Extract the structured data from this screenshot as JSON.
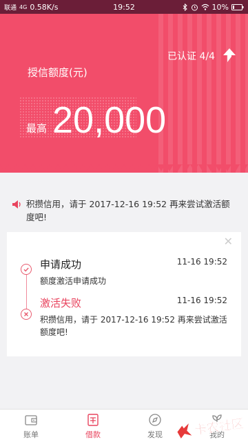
{
  "status_bar": {
    "carrier": "联通",
    "signal": "4G",
    "speed": "0.58K/s",
    "time": "19:52",
    "battery": "10%",
    "icons": [
      "bluetooth-icon",
      "alarm-icon",
      "wifi-icon",
      "battery-icon"
    ]
  },
  "hero": {
    "verified_label": "已认证 4/4",
    "credit_label": "授信额度(元)",
    "amount_prefix": "最高",
    "amount": "20,000",
    "bg_color": "#f24d6a"
  },
  "notice": {
    "icon": "speaker-icon",
    "text": "积攒信用，请于 2017-12-16 19:52 再来尝试激活额度吧!"
  },
  "timeline": [
    {
      "title": "申请成功",
      "time": "11-16 19:52",
      "desc": "额度激活申请成功",
      "status": "success"
    },
    {
      "title": "激活失败",
      "time": "11-16 19:52",
      "desc": "积攒信用，请于 2017-12-16 19:52 再来尝试激活额度吧!",
      "status": "failed"
    }
  ],
  "nav": [
    {
      "label": "账单",
      "icon": "wallet-icon",
      "active": false
    },
    {
      "label": "借款",
      "icon": "loan-icon",
      "active": true
    },
    {
      "label": "发现",
      "icon": "discover-icon",
      "active": false
    },
    {
      "label": "我的",
      "icon": "profile-icon",
      "active": false
    }
  ],
  "watermark": {
    "text": "卡农社区"
  },
  "colors": {
    "accent": "#e8445e",
    "status_bar": "#6b1e38"
  }
}
